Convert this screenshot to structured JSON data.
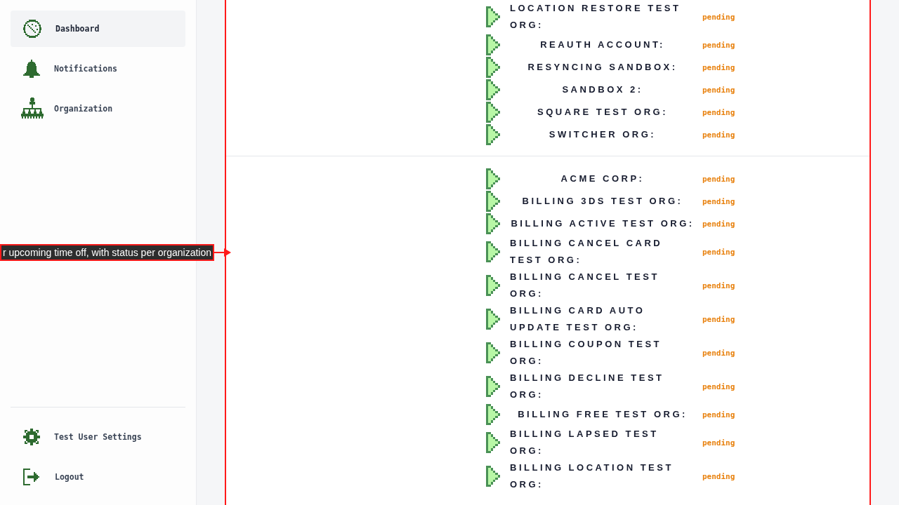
{
  "sidebar": {
    "items": [
      {
        "label": "Dashboard",
        "selected": true
      },
      {
        "label": "Notifications",
        "selected": false
      },
      {
        "label": "Organization",
        "selected": false
      }
    ],
    "footer_items": [
      {
        "label": "Test User Settings",
        "selected": false
      },
      {
        "label": "Logout",
        "selected": false
      }
    ]
  },
  "panel": {
    "groups": [
      {
        "rows": [
          {
            "name": "LOCATION RESTORE TEST ORG:",
            "status": "pending"
          },
          {
            "name": "REAUTH ACCOUNT:",
            "status": "pending"
          },
          {
            "name": "RESYNCING SANDBOX:",
            "status": "pending"
          },
          {
            "name": "SANDBOX 2:",
            "status": "pending"
          },
          {
            "name": "SQUARE TEST ORG:",
            "status": "pending"
          },
          {
            "name": "SWITCHER ORG:",
            "status": "pending"
          }
        ]
      },
      {
        "rows": [
          {
            "name": "ACME CORP:",
            "status": "pending"
          },
          {
            "name": "BILLING 3DS TEST ORG:",
            "status": "pending"
          },
          {
            "name": "BILLING ACTIVE TEST ORG:",
            "status": "pending"
          },
          {
            "name": "BILLING CANCEL CARD TEST ORG:",
            "status": "pending"
          },
          {
            "name": "BILLING CANCEL TEST ORG:",
            "status": "pending"
          },
          {
            "name": "BILLING CARD AUTO UPDATE TEST ORG:",
            "status": "pending"
          },
          {
            "name": "BILLING COUPON TEST ORG:",
            "status": "pending"
          },
          {
            "name": "BILLING DECLINE TEST ORG:",
            "status": "pending"
          },
          {
            "name": "BILLING FREE TEST ORG:",
            "status": "pending"
          },
          {
            "name": "BILLING LAPSED TEST ORG:",
            "status": "pending"
          },
          {
            "name": "BILLING LOCATION TEST ORG:",
            "status": "pending"
          }
        ]
      }
    ]
  },
  "callout": {
    "text": "r upcoming time off, with status per organization"
  }
}
